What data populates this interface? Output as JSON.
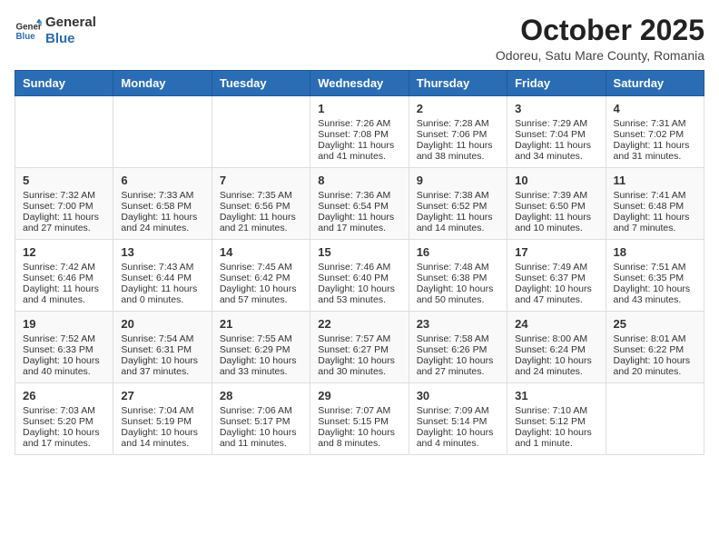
{
  "header": {
    "logo_line1": "General",
    "logo_line2": "Blue",
    "month_title": "October 2025",
    "location": "Odoreu, Satu Mare County, Romania"
  },
  "weekdays": [
    "Sunday",
    "Monday",
    "Tuesday",
    "Wednesday",
    "Thursday",
    "Friday",
    "Saturday"
  ],
  "weeks": [
    [
      {
        "day": "",
        "content": ""
      },
      {
        "day": "",
        "content": ""
      },
      {
        "day": "",
        "content": ""
      },
      {
        "day": "1",
        "content": "Sunrise: 7:26 AM\nSunset: 7:08 PM\nDaylight: 11 hours\nand 41 minutes."
      },
      {
        "day": "2",
        "content": "Sunrise: 7:28 AM\nSunset: 7:06 PM\nDaylight: 11 hours\nand 38 minutes."
      },
      {
        "day": "3",
        "content": "Sunrise: 7:29 AM\nSunset: 7:04 PM\nDaylight: 11 hours\nand 34 minutes."
      },
      {
        "day": "4",
        "content": "Sunrise: 7:31 AM\nSunset: 7:02 PM\nDaylight: 11 hours\nand 31 minutes."
      }
    ],
    [
      {
        "day": "5",
        "content": "Sunrise: 7:32 AM\nSunset: 7:00 PM\nDaylight: 11 hours\nand 27 minutes."
      },
      {
        "day": "6",
        "content": "Sunrise: 7:33 AM\nSunset: 6:58 PM\nDaylight: 11 hours\nand 24 minutes."
      },
      {
        "day": "7",
        "content": "Sunrise: 7:35 AM\nSunset: 6:56 PM\nDaylight: 11 hours\nand 21 minutes."
      },
      {
        "day": "8",
        "content": "Sunrise: 7:36 AM\nSunset: 6:54 PM\nDaylight: 11 hours\nand 17 minutes."
      },
      {
        "day": "9",
        "content": "Sunrise: 7:38 AM\nSunset: 6:52 PM\nDaylight: 11 hours\nand 14 minutes."
      },
      {
        "day": "10",
        "content": "Sunrise: 7:39 AM\nSunset: 6:50 PM\nDaylight: 11 hours\nand 10 minutes."
      },
      {
        "day": "11",
        "content": "Sunrise: 7:41 AM\nSunset: 6:48 PM\nDaylight: 11 hours\nand 7 minutes."
      }
    ],
    [
      {
        "day": "12",
        "content": "Sunrise: 7:42 AM\nSunset: 6:46 PM\nDaylight: 11 hours\nand 4 minutes."
      },
      {
        "day": "13",
        "content": "Sunrise: 7:43 AM\nSunset: 6:44 PM\nDaylight: 11 hours\nand 0 minutes."
      },
      {
        "day": "14",
        "content": "Sunrise: 7:45 AM\nSunset: 6:42 PM\nDaylight: 10 hours\nand 57 minutes."
      },
      {
        "day": "15",
        "content": "Sunrise: 7:46 AM\nSunset: 6:40 PM\nDaylight: 10 hours\nand 53 minutes."
      },
      {
        "day": "16",
        "content": "Sunrise: 7:48 AM\nSunset: 6:38 PM\nDaylight: 10 hours\nand 50 minutes."
      },
      {
        "day": "17",
        "content": "Sunrise: 7:49 AM\nSunset: 6:37 PM\nDaylight: 10 hours\nand 47 minutes."
      },
      {
        "day": "18",
        "content": "Sunrise: 7:51 AM\nSunset: 6:35 PM\nDaylight: 10 hours\nand 43 minutes."
      }
    ],
    [
      {
        "day": "19",
        "content": "Sunrise: 7:52 AM\nSunset: 6:33 PM\nDaylight: 10 hours\nand 40 minutes."
      },
      {
        "day": "20",
        "content": "Sunrise: 7:54 AM\nSunset: 6:31 PM\nDaylight: 10 hours\nand 37 minutes."
      },
      {
        "day": "21",
        "content": "Sunrise: 7:55 AM\nSunset: 6:29 PM\nDaylight: 10 hours\nand 33 minutes."
      },
      {
        "day": "22",
        "content": "Sunrise: 7:57 AM\nSunset: 6:27 PM\nDaylight: 10 hours\nand 30 minutes."
      },
      {
        "day": "23",
        "content": "Sunrise: 7:58 AM\nSunset: 6:26 PM\nDaylight: 10 hours\nand 27 minutes."
      },
      {
        "day": "24",
        "content": "Sunrise: 8:00 AM\nSunset: 6:24 PM\nDaylight: 10 hours\nand 24 minutes."
      },
      {
        "day": "25",
        "content": "Sunrise: 8:01 AM\nSunset: 6:22 PM\nDaylight: 10 hours\nand 20 minutes."
      }
    ],
    [
      {
        "day": "26",
        "content": "Sunrise: 7:03 AM\nSunset: 5:20 PM\nDaylight: 10 hours\nand 17 minutes."
      },
      {
        "day": "27",
        "content": "Sunrise: 7:04 AM\nSunset: 5:19 PM\nDaylight: 10 hours\nand 14 minutes."
      },
      {
        "day": "28",
        "content": "Sunrise: 7:06 AM\nSunset: 5:17 PM\nDaylight: 10 hours\nand 11 minutes."
      },
      {
        "day": "29",
        "content": "Sunrise: 7:07 AM\nSunset: 5:15 PM\nDaylight: 10 hours\nand 8 minutes."
      },
      {
        "day": "30",
        "content": "Sunrise: 7:09 AM\nSunset: 5:14 PM\nDaylight: 10 hours\nand 4 minutes."
      },
      {
        "day": "31",
        "content": "Sunrise: 7:10 AM\nSunset: 5:12 PM\nDaylight: 10 hours\nand 1 minute."
      },
      {
        "day": "",
        "content": ""
      }
    ]
  ]
}
